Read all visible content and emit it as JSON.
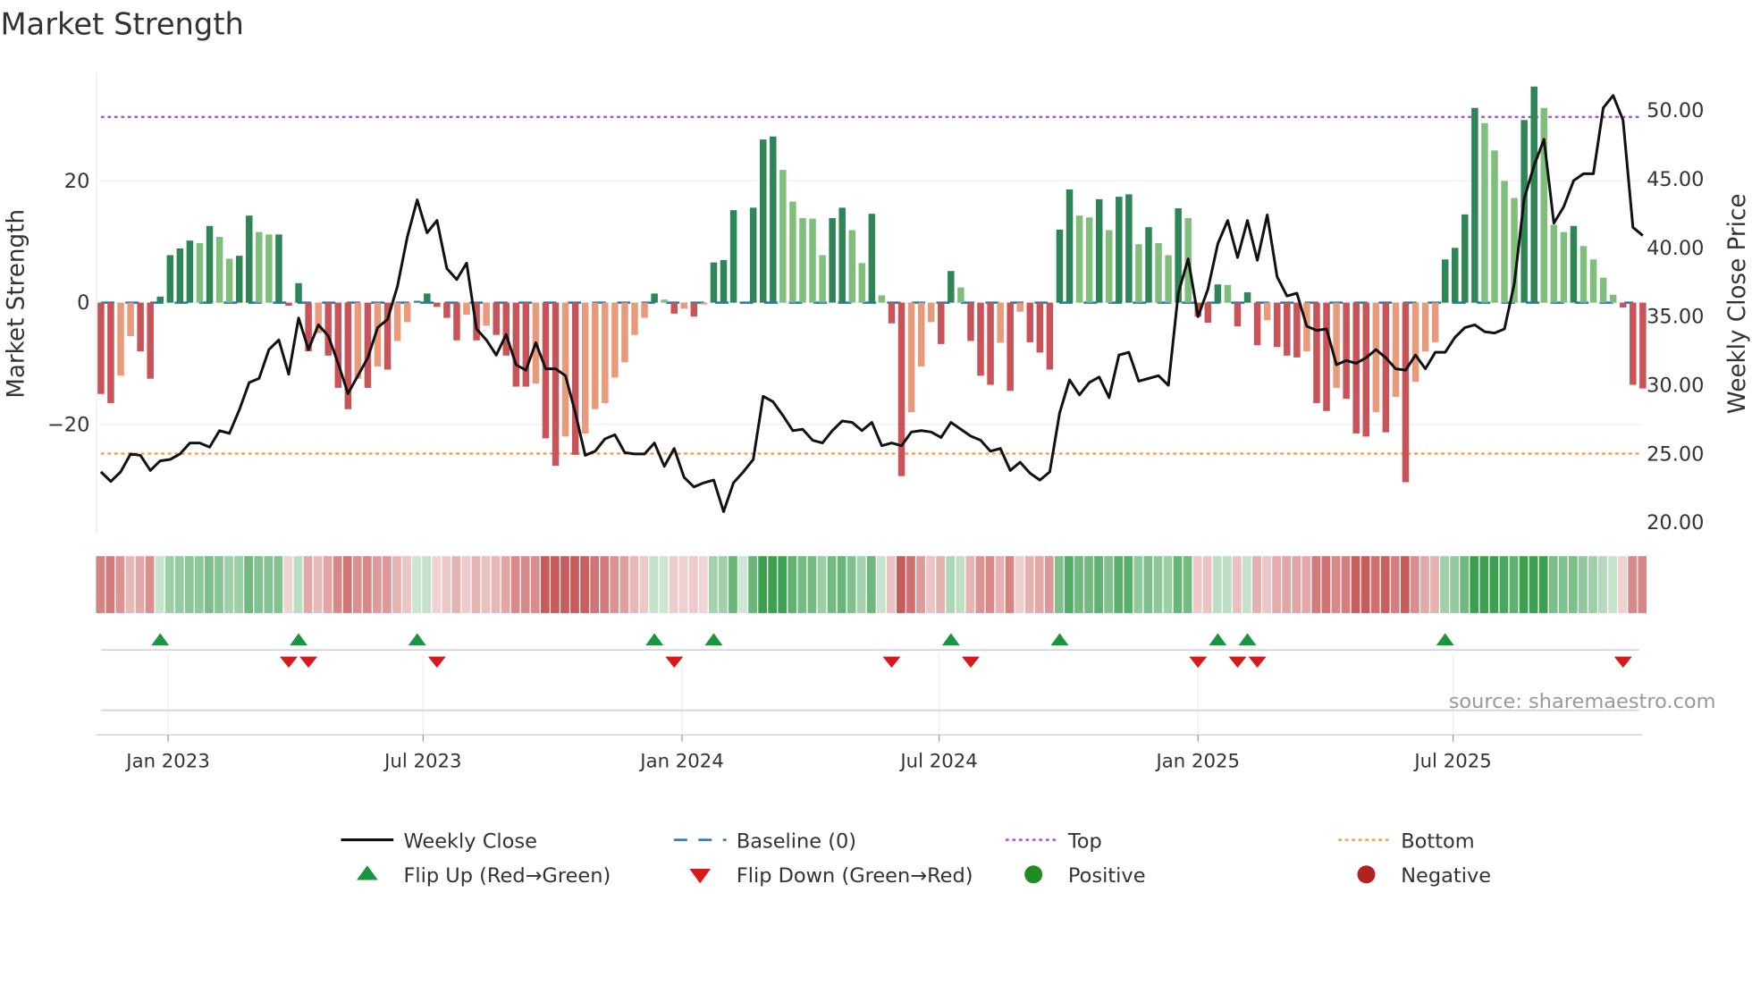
{
  "title": "Market Strength",
  "source": "source: sharemaestro.com",
  "colors": {
    "pos_strong": "#2e8555",
    "pos_weak": "#7fbf7b",
    "neg_strong": "#c8545a",
    "neg_weak": "#e89a7a",
    "line": "#111111",
    "baseline": "#1f77b4",
    "top": "#9b59d6",
    "bottom": "#f0a050",
    "flip_up": "#1a9641",
    "flip_down": "#d7191c",
    "positive": "#228b22",
    "negative": "#b22222"
  },
  "chart_data": {
    "type": "bar",
    "title": "Market Strength",
    "start_week": "2022-11-14",
    "frequency": "weekly",
    "ylabel": "Market Strength",
    "y2label": "Weekly Close Price",
    "ylim": [
      -38,
      38
    ],
    "y2lim": [
      18.3,
      53.1
    ],
    "yticks": [
      {
        "v": 20,
        "label": "20"
      },
      {
        "v": 0,
        "label": "0"
      },
      {
        "v": -20,
        "label": "−20"
      }
    ],
    "y2ticks": [
      {
        "v": 50,
        "label": "50.00"
      },
      {
        "v": 45,
        "label": "45.00"
      },
      {
        "v": 40,
        "label": "40.00"
      },
      {
        "v": 35,
        "label": "35.00"
      },
      {
        "v": 30,
        "label": "30.00"
      },
      {
        "v": 25,
        "label": "25.00"
      },
      {
        "v": 20,
        "label": "20.00"
      }
    ],
    "xticks": [
      {
        "week": 6.8,
        "label": "Jan 2023"
      },
      {
        "week": 32.6,
        "label": "Jul 2023"
      },
      {
        "week": 58.8,
        "label": "Jan 2024"
      },
      {
        "week": 84.8,
        "label": "Jul 2024"
      },
      {
        "week": 111,
        "label": "Jan 2025"
      },
      {
        "week": 136.8,
        "label": "Jul 2025"
      }
    ],
    "top_level": 30.5,
    "bottom_level": -24.8,
    "strength": [
      -15,
      -16.5,
      -12,
      -5.5,
      -8,
      -12.5,
      1,
      7.8,
      8.9,
      10.2,
      9.8,
      12.6,
      10.8,
      7.2,
      7.7,
      14.3,
      11.6,
      11.2,
      11.2,
      -0.5,
      3.2,
      -8,
      -5,
      -8.7,
      -14,
      -17.5,
      -12.5,
      -14,
      -10.5,
      -11,
      -6.3,
      -3.2,
      0.3,
      1.5,
      -0.7,
      -2.5,
      -6.2,
      -2,
      -6.2,
      -3.8,
      -5.3,
      -8.7,
      -13.8,
      -13.8,
      -13.3,
      -22.3,
      -26.8,
      -22,
      -25,
      -21.5,
      -17.5,
      -16.5,
      -12.3,
      -9.8,
      -5.3,
      -2.5,
      1.5,
      0.5,
      -1.8,
      -1,
      -2.3,
      -0.3,
      6.6,
      7,
      15.2,
      0,
      15.6,
      26.8,
      27.3,
      21.8,
      16.6,
      13.9,
      13.8,
      7.8,
      13.9,
      15.6,
      11.9,
      6.5,
      14.6,
      1.2,
      -3.4,
      -28.5,
      -18,
      -10.5,
      -3.2,
      -6.8,
      5.2,
      2.5,
      -6.3,
      -12,
      -13.5,
      -6.6,
      -14.5,
      -1.5,
      -6.5,
      -8.2,
      -11,
      12,
      18.6,
      14.3,
      14,
      17,
      11.9,
      17.4,
      17.8,
      9.6,
      12.4,
      9.8,
      7.8,
      15.5,
      13.9,
      -2.3,
      -3.3,
      3,
      2.9,
      -3.9,
      1.7,
      -7,
      -2.9,
      -7.3,
      -8.7,
      -9,
      -8,
      -16.5,
      -17.8,
      -14,
      -15.8,
      -21.5,
      -22,
      -18,
      -21.3,
      -15.5,
      -29.5,
      -13,
      -8,
      -6.5,
      7.1,
      9,
      14.5,
      32,
      29.5,
      25,
      20,
      17.2,
      30,
      35.5,
      32,
      12.8,
      11.6,
      12.6,
      9.3,
      7.1,
      4.1,
      1.3,
      -0.8,
      -13.5,
      -14.1
    ],
    "close": [
      23.7,
      23.0,
      23.7,
      25.0,
      24.9,
      23.8,
      24.5,
      24.6,
      25.0,
      25.8,
      25.8,
      25.5,
      26.7,
      26.5,
      28.2,
      30.2,
      30.5,
      32.6,
      33.3,
      30.8,
      34.9,
      32.6,
      34.4,
      33.6,
      31.6,
      29.4,
      30.7,
      32.0,
      34.2,
      34.8,
      37.2,
      40.8,
      43.5,
      41.1,
      42.0,
      38.5,
      37.7,
      38.9,
      34.1,
      33.3,
      32.2,
      33.7,
      31.5,
      31.1,
      33.1,
      31.2,
      31.2,
      30.7,
      28.0,
      24.9,
      25.2,
      26.1,
      26.4,
      25.1,
      25.0,
      25.0,
      25.8,
      24.1,
      25.4,
      23.3,
      22.6,
      22.9,
      23.1,
      20.8,
      22.9,
      23.7,
      24.6,
      29.2,
      28.8,
      27.8,
      26.7,
      26.8,
      26.0,
      25.8,
      26.7,
      27.4,
      27.3,
      26.7,
      27.3,
      25.6,
      25.8,
      25.6,
      26.6,
      26.7,
      26.6,
      26.2,
      27.3,
      26.8,
      26.3,
      26.0,
      25.2,
      25.4,
      23.8,
      24.4,
      23.6,
      23.1,
      23.7,
      28.0,
      30.4,
      29.3,
      30.2,
      30.6,
      29.1,
      32.2,
      32.4,
      30.3,
      30.5,
      30.7,
      30.0,
      36.7,
      39.2,
      35.0,
      37.0,
      40.3,
      42.0,
      39.3,
      42.0,
      39.1,
      42.4,
      37.9,
      36.5,
      36.7,
      34.3,
      34.0,
      34.1,
      31.5,
      31.8,
      31.6,
      32.0,
      32.6,
      32.0,
      31.2,
      31.1,
      32.2,
      31.2,
      32.4,
      32.4,
      33.5,
      34.2,
      34.4,
      33.9,
      33.8,
      34.1,
      37.4,
      43.6,
      46.0,
      47.9,
      41.8,
      43.0,
      44.9,
      45.4,
      45.4,
      50.2,
      51.1,
      49.3,
      41.5,
      40.9
    ],
    "flip_up_weeks": [
      6,
      20,
      32,
      56,
      62,
      86,
      97,
      113,
      116,
      136
    ],
    "flip_down_weeks": [
      19,
      21,
      34,
      58,
      80,
      88,
      111,
      115,
      117,
      154
    ],
    "legend": {
      "placement": "bottom",
      "items": [
        {
          "key": "line",
          "label": "Weekly Close"
        },
        {
          "key": "baseline",
          "label": "Baseline (0)"
        },
        {
          "key": "top",
          "label": "Top"
        },
        {
          "key": "bottom",
          "label": "Bottom"
        },
        {
          "key": "flip_up",
          "label": "Flip Up (Red→Green)"
        },
        {
          "key": "flip_down",
          "label": "Flip Down (Green→Red)"
        },
        {
          "key": "positive",
          "label": "Positive"
        },
        {
          "key": "negative",
          "label": "Negative"
        }
      ]
    }
  }
}
